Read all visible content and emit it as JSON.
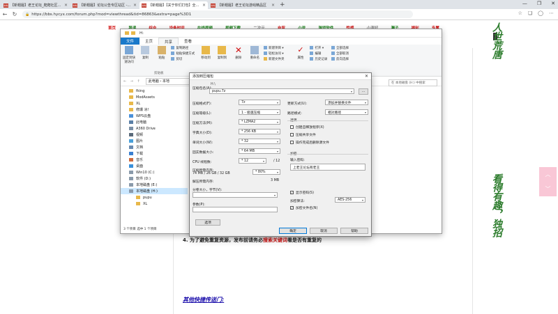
{
  "browser": {
    "tabs": [
      {
        "label": "【新帽履】老王论坛_爬爬社区论坛",
        "favicon": "新帽"
      },
      {
        "label": "【新帽履】论坛公告专区站区 - 老王论坛",
        "favicon": "新帽"
      },
      {
        "label": "【新帽履】【关于你们打包】全站 - 老王论坛",
        "favicon": "新帽",
        "active": true
      },
      {
        "label": "【新帽履】老王论坛游戏精品区",
        "favicon": "新帽"
      }
    ],
    "newtab": "+",
    "window_controls": [
      "—",
      "❐",
      "✕"
    ],
    "url": "https://bbs.hycyx.com/forum.php?mod=viewthread&tid=86863&extra=page%3D1"
  },
  "site": {
    "nav": [
      "首页",
      "导读",
      "综合",
      "设备时间",
      "在线视频",
      "视频下载",
      "二次元",
      "自留",
      "小说",
      "游戏软件",
      "性感",
      "小清好",
      "漏子",
      "福利",
      "专属"
    ],
    "article_line_prefix": "4. 为了避免重复资源，发布前请务必",
    "article_line_highlight": "搜索关键词",
    "article_line_suffix": "看是否有重复的",
    "footer_link": "其他快捷传送门:",
    "banner_top": "人世荒唐",
    "banner_mid": "看得有趣，独招",
    "scroll_up": "︿",
    "scroll_down": "﹀"
  },
  "explorer": {
    "title": "H:",
    "tabs": [
      "文件",
      "主页",
      "共享",
      "查看"
    ],
    "ribbon": {
      "pin_label": "固定到快速访问",
      "copy_label": "复制",
      "paste_label": "粘贴",
      "copy_path": "复制路径",
      "paste_shortcut": "粘贴快捷方式",
      "cut": "剪切",
      "clipboard_group": "剪贴板",
      "move_to": "移动到",
      "copy_to": "复制到",
      "delete": "删除",
      "rename": "重命名",
      "new_item": "新建项目 ▾",
      "easy_access": "轻松访问 ▾",
      "new_folder": "新建文件夹",
      "properties": "属性",
      "open": "打开 ▾",
      "edit": "编辑",
      "history": "历史记录",
      "select_all": "全部选择",
      "select_none": "全部取消",
      "invert": "反向选择"
    },
    "breadcrumb": "此电脑 › 本地",
    "search_placeholder": "在 本地磁盘 (H:) 中搜索",
    "nav_items": [
      {
        "label": "fking",
        "icon": "folder"
      },
      {
        "label": "ModAssets",
        "icon": "folder"
      },
      {
        "label": "XL",
        "icon": "folder"
      },
      {
        "label": "修爆 冰!",
        "icon": "folder"
      },
      {
        "label": "WPS云盘",
        "icon": "cloud"
      },
      {
        "label": "此电脑",
        "icon": "pc"
      },
      {
        "label": "A360 Drive",
        "icon": "drive"
      },
      {
        "label": "视频",
        "icon": "video"
      },
      {
        "label": "图片",
        "icon": "picture"
      },
      {
        "label": "文档",
        "icon": "doc"
      },
      {
        "label": "下载",
        "icon": "download"
      },
      {
        "label": "音乐",
        "icon": "music"
      },
      {
        "label": "桌面",
        "icon": "desktop"
      },
      {
        "label": "Win10 (C:)",
        "icon": "disk"
      },
      {
        "label": "软件 (D:)",
        "icon": "disk"
      },
      {
        "label": "本地磁盘 (E:)",
        "icon": "disk"
      },
      {
        "label": "本地磁盘 (H:)",
        "icon": "disk",
        "selected": true
      },
      {
        "label": "pupu",
        "icon": "folder",
        "indent": true
      },
      {
        "label": "XL",
        "icon": "folder",
        "indent": true
      }
    ],
    "status": "3 个项目   选中 1 个项目"
  },
  "dialog": {
    "title": "添加到压缩包",
    "archive_name_label": "压缩包名(A):",
    "archive_path_hint": "H:\\",
    "archive_name": "pupu.7z",
    "browse": "...",
    "format_label": "压缩格式(F):",
    "format": "7z",
    "level_label": "压缩等级(L):",
    "level": "1 - 极速压缩",
    "method_label": "压缩方法(M):",
    "method": "* LZMA2",
    "dict_label": "字典大小(D):",
    "dict": "* 256 KB",
    "word_label": "单词大小(W):",
    "word": "* 32",
    "solid_label": "固实数据大小:",
    "solid": "* 64 MB",
    "cpu_label": "CPU 线程数:",
    "cpu": "* 12",
    "cpu_total": "/ 12",
    "mem_label": "压缩所需内存:",
    "mem_value": "74 MB / 26 GB / 32 GB",
    "mem_pct": "* 80%",
    "decomp_label": "解压所需内存:",
    "decomp": "3 MB",
    "split_label": "分卷大小，字节(V):",
    "params_label": "参数(P):",
    "options_btn": "选项",
    "update_label": "更新方式(U):",
    "update": "添加并替换文件",
    "pathmode_label": "路径模式:",
    "pathmode": "相对路径",
    "options_group": "选项",
    "opt_sfx": "创建自释放程序(X)",
    "opt_shared": "压缩共享文件",
    "opt_delete": "操作完成后删除源文件",
    "enc_group": "加密",
    "password_label": "输入密码:",
    "password": "上老王论坛有老王",
    "show_password": "显示密码(S)",
    "enc_method_label": "加密算法:",
    "enc_method": "AES-256",
    "enc_names": "加密文件名(N)",
    "ok": "确定",
    "cancel": "取消",
    "help": "帮助"
  },
  "colors": {
    "accent_file_tab": "#1979ca",
    "nav_red": "#d01010",
    "banner_green": "#2e7d2e"
  }
}
